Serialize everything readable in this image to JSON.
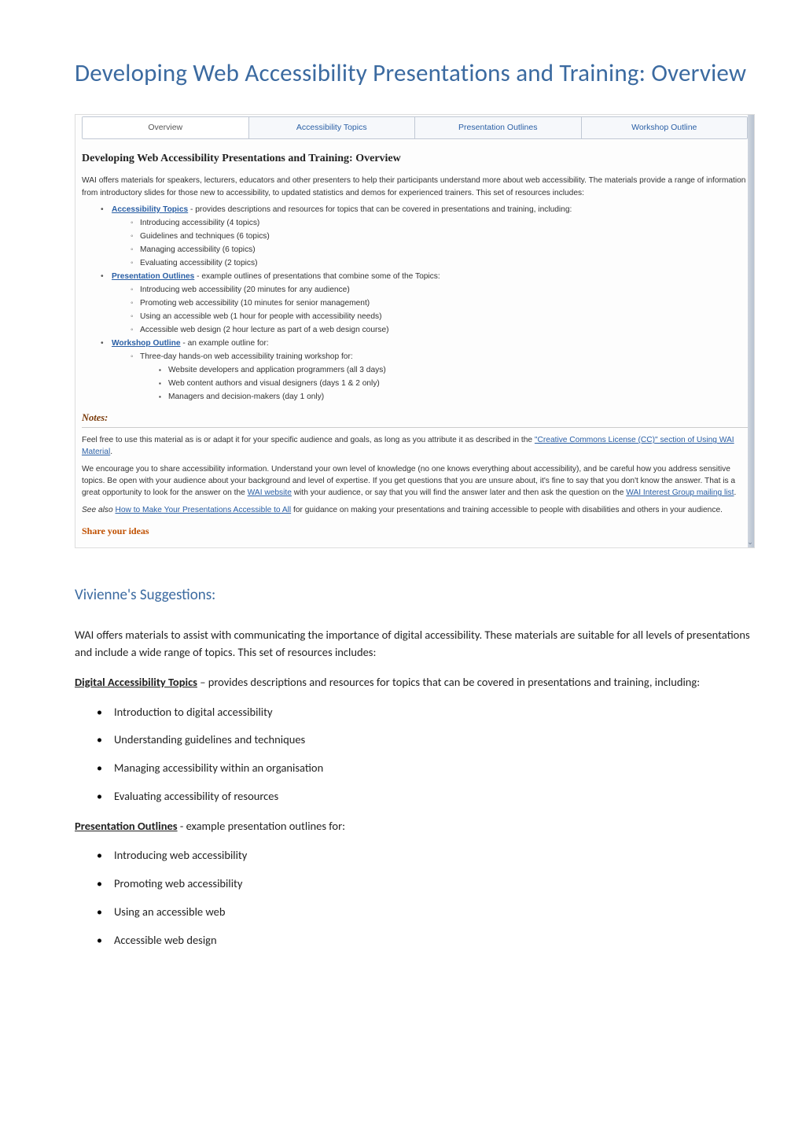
{
  "page": {
    "title": "Developing Web Accessibility Presentations and Training: Overview"
  },
  "screenshot": {
    "tabs": [
      "Overview",
      "Accessibility Topics",
      "Presentation Outlines",
      "Workshop Outline"
    ],
    "heading": "Developing Web Accessibility Presentations and Training: Overview",
    "intro": "WAI offers materials for speakers, lecturers, educators and other presenters to help their participants understand more about web accessibility. The materials provide a range of information from introductory slides for those new to accessibility, to updated statistics and demos for experienced trainers. This set of resources includes:",
    "sec1": {
      "link": "Accessibility Topics",
      "rest": " - provides descriptions and resources for topics that can be covered in presentations and training, including:",
      "items": [
        "Introducing accessibility (4 topics)",
        "Guidelines and techniques (6 topics)",
        "Managing accessibility (6 topics)",
        "Evaluating accessibility (2 topics)"
      ]
    },
    "sec2": {
      "link": "Presentation Outlines",
      "rest": " - example outlines of presentations that combine some of the Topics:",
      "items": [
        "Introducing web accessibility (20 minutes for any audience)",
        "Promoting web accessibility (10 minutes for senior management)",
        "Using an accessible web (1 hour for people with accessibility needs)",
        "Accessible web design (2 hour lecture as part of a web design course)"
      ]
    },
    "sec3": {
      "link": "Workshop Outline",
      "rest": " - an example outline for:",
      "lead": "Three-day hands-on web accessibility training workshop for:",
      "items": [
        "Website developers and application programmers (all 3 days)",
        "Web content authors and visual designers (days 1 & 2 only)",
        "Managers and decision-makers (day 1 only)"
      ]
    },
    "notes_heading": "Notes:",
    "notes_p1a": "Feel free to use this material as is or adapt it for your specific audience and goals, as long as you attribute it as described in the ",
    "notes_p1_link": "\"Creative Commons License (CC)\" section of Using WAI Material",
    "notes_p1b": ".",
    "notes_p2a": "We encourage you to share accessibility information. Understand your own level of knowledge (no one knows everything about accessibility), and be careful how you address sensitive topics. Be open with your audience about your background and level of expertise. If you get questions that you are unsure about, it's fine to say that you don't know the answer. That is a great opportunity to look for the answer on the ",
    "notes_p2_link1": "WAI website",
    "notes_p2b": " with your audience, or say that you will find the answer later and then ask the question on the ",
    "notes_p2_link2": "WAI Interest Group mailing list",
    "notes_p2c": ".",
    "notes_p3a": "See also ",
    "notes_p3_link": "How to Make Your Presentations Accessible to All",
    "notes_p3b": " for guidance on making your presentations and training accessible to people with disabilities and others in your audience.",
    "share": "Share your ideas"
  },
  "doc": {
    "subheading": "Vivienne's Suggestions:",
    "para1": "WAI offers materials to assist with communicating the importance of digital accessibility.  These materials are suitable for all levels of presentations and include a wide range of topics.  This set of resources includes:",
    "topics_label": "Digital Accessibility Topics",
    "topics_rest": " – provides descriptions and resources for topics that can be covered in presentations and training, including:",
    "topics_items": [
      "Introduction to digital accessibility",
      "Understanding guidelines and techniques",
      "Managing accessibility within an organisation",
      "Evaluating accessibility of resources"
    ],
    "outlines_label": "Presentation Outlines",
    "outlines_rest": " - example presentation outlines for:",
    "outlines_items": [
      "Introducing web accessibility",
      "Promoting web accessibility",
      "Using an accessible web",
      "Accessible web design"
    ]
  }
}
